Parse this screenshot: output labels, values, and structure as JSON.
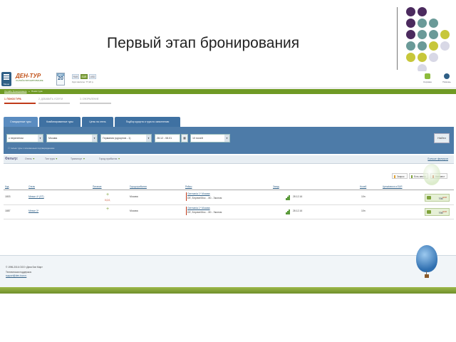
{
  "slide": {
    "title": "Первый этап бронирования"
  },
  "colors": {
    "accent_green": "#6f9a25",
    "panel_blue": "#4d7ba8",
    "tab_blue": "#3f71a2",
    "link_blue": "#2f5f86",
    "step_red": "#c03a1a",
    "dot_purple": "#4b2a5e",
    "dot_teal": "#6a9a98",
    "dot_olive": "#c7c73a"
  },
  "header": {
    "menu_label": "Меню",
    "logo_text": "ДЕН-ТУР",
    "logo_subtitle": "ОНЛАЙН БРОНИРОВАНИЕ",
    "date_month": "ДЕК",
    "date_day": "20",
    "currencies": [
      "RUB",
      "EUR",
      "USD"
    ],
    "active_currency": "EUR",
    "rate_text": "Курс валюты: 77,22 р.",
    "right_icons": [
      {
        "icon": "basket-icon",
        "label": "Корзина"
      },
      {
        "icon": "help-icon",
        "label": "Помощь"
      }
    ]
  },
  "greenbar": {
    "link": "Онлайн бронирование",
    "current": "Поиск тура"
  },
  "steps": [
    {
      "label": "1. ПОИСК ТУРА",
      "active": true
    },
    {
      "label": "2. ДОБАВИТЬ УСЛУГИ",
      "active": false
    },
    {
      "label": "3. ОФОРМЛЕНИЕ",
      "active": false
    }
  ],
  "tabs": [
    {
      "label": "Стандартные туры",
      "active": true
    },
    {
      "label": "Комбинированные туры",
      "active": false
    },
    {
      "label": "Цены на отель",
      "active": false
    },
    {
      "label": "Подбор курорта и тура по заполнению",
      "active": false
    }
  ],
  "search": {
    "transport": "с перелетом",
    "departure_city": "Москва",
    "destination": "Германия (курортов - 1)",
    "dates": "28.12 - 08.01",
    "nights": "10 ночей",
    "checkbox_label": "только туры с мгновенным подтверждением",
    "find_button": "Найти"
  },
  "filter": {
    "label": "Фильтр:",
    "items": [
      "Отель",
      "Тип тура",
      "Транспорт",
      "Город прибытия"
    ],
    "more_link": "Больше фильтров"
  },
  "legend": [
    {
      "label": "Запрос",
      "color": "#e0a030"
    },
    {
      "label": "Есть места",
      "color": "#7fa33b"
    },
    {
      "label": "Нет мест",
      "color": "#c03a1a"
    }
  ],
  "table": {
    "headers": [
      "Код",
      "Отель",
      "Питание",
      "Город прибытия",
      "Рейсы",
      "Заезд",
      "Ночей",
      "Цена/места в EUR"
    ],
    "rows": [
      {
        "code": "1803",
        "hotel": "Messe 4* (ST)",
        "meal": "+",
        "meal_note": "0,0,0,",
        "city": "Москва",
        "flight_1": "Germania 1* Москва",
        "flight_2": "DE, Берлин/Мос. - 80 - Эконом",
        "date": "28.12.16",
        "nights": "10н",
        "price": "798",
        "price_currency": "EUR"
      },
      {
        "code": "1887",
        "hotel": "Messe 3*",
        "meal": "+",
        "meal_note": "",
        "city": "Москва",
        "flight_1": "Germania 1* Москва",
        "flight_2": "DE, Берлин/Мос. - 80 - Эконом",
        "date": "28.12.16",
        "nights": "10н",
        "price": "798",
        "price_currency": "EUR"
      }
    ]
  },
  "footer": {
    "copyright": "© 1996-2016 ООО «Дэни Бэн Мир»",
    "support": "Техническая поддержка:",
    "email": "support@den-tour.ru"
  }
}
